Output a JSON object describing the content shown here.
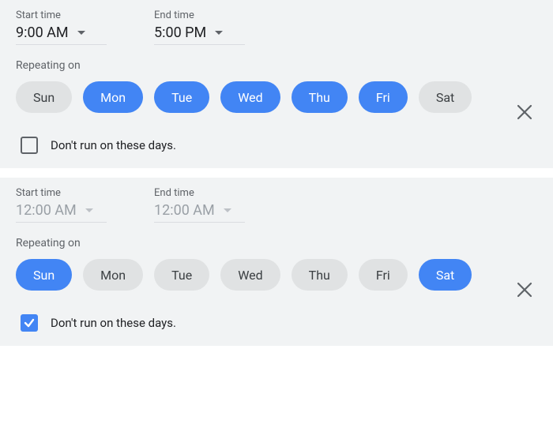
{
  "labels": {
    "start_time": "Start time",
    "end_time": "End time",
    "repeating_on": "Repeating on",
    "dont_run": "Don't run on these days."
  },
  "days": [
    "Sun",
    "Mon",
    "Tue",
    "Wed",
    "Thu",
    "Fri",
    "Sat"
  ],
  "schedules": [
    {
      "start_value": "9:00 AM",
      "end_value": "5:00 PM",
      "disabled": false,
      "selected_days": [
        false,
        true,
        true,
        true,
        true,
        true,
        false
      ],
      "dont_run_checked": false
    },
    {
      "start_value": "12:00 AM",
      "end_value": "12:00 AM",
      "disabled": true,
      "selected_days": [
        true,
        false,
        false,
        false,
        false,
        false,
        true
      ],
      "dont_run_checked": true
    }
  ]
}
